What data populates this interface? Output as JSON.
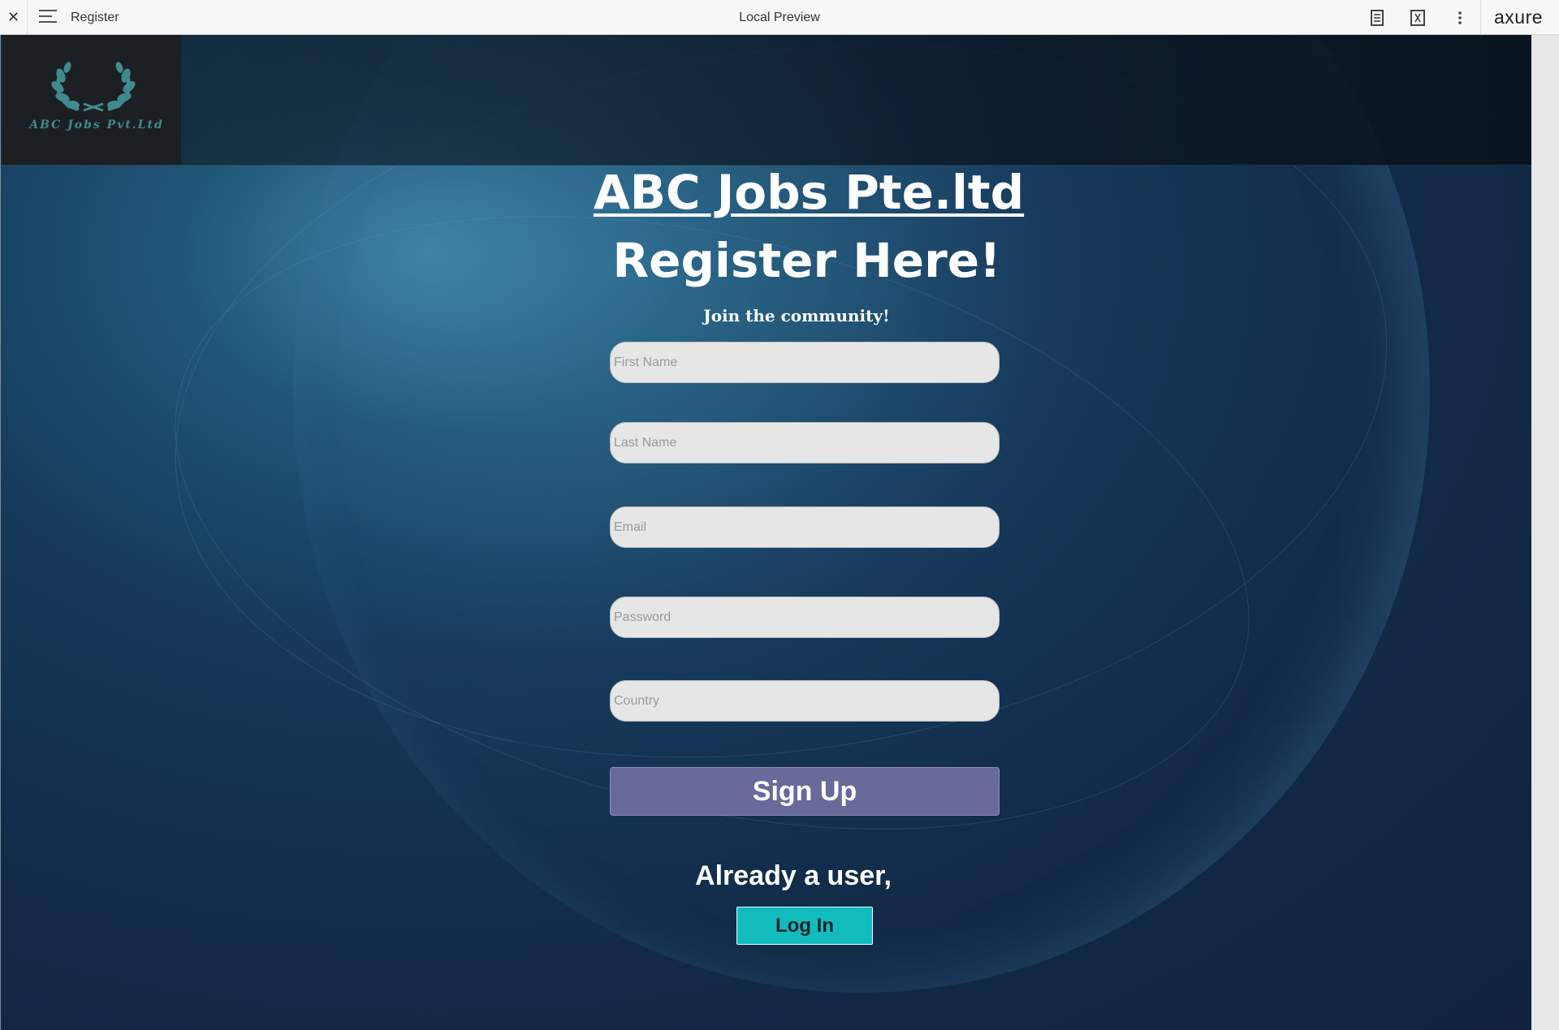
{
  "toolbar": {
    "close_glyph": "✕",
    "page_name": "Register",
    "center_title": "Local Preview",
    "brand": "axure",
    "icons": [
      "close-icon",
      "menu-icon",
      "notes-icon",
      "variables-icon",
      "more-icon"
    ]
  },
  "page": {
    "logo_text": "ABC Jobs Pvt.Ltd",
    "title": "ABC Jobs Pte.ltd",
    "subtitle": "Register Here!",
    "tagline": "Join the community!",
    "fields": {
      "first_name": "First Name",
      "last_name": "Last Name",
      "email": "Email",
      "password": "Password",
      "country": "Country"
    },
    "signup_label": "Sign Up",
    "already_text": "Already a user,",
    "login_label": "Log In"
  },
  "colors": {
    "background": "#122b49",
    "signup_button": "#686a9a",
    "login_button": "#12bcbc",
    "logo_teal": "#3f8a8e",
    "field_bg": "#e6e6e6"
  }
}
